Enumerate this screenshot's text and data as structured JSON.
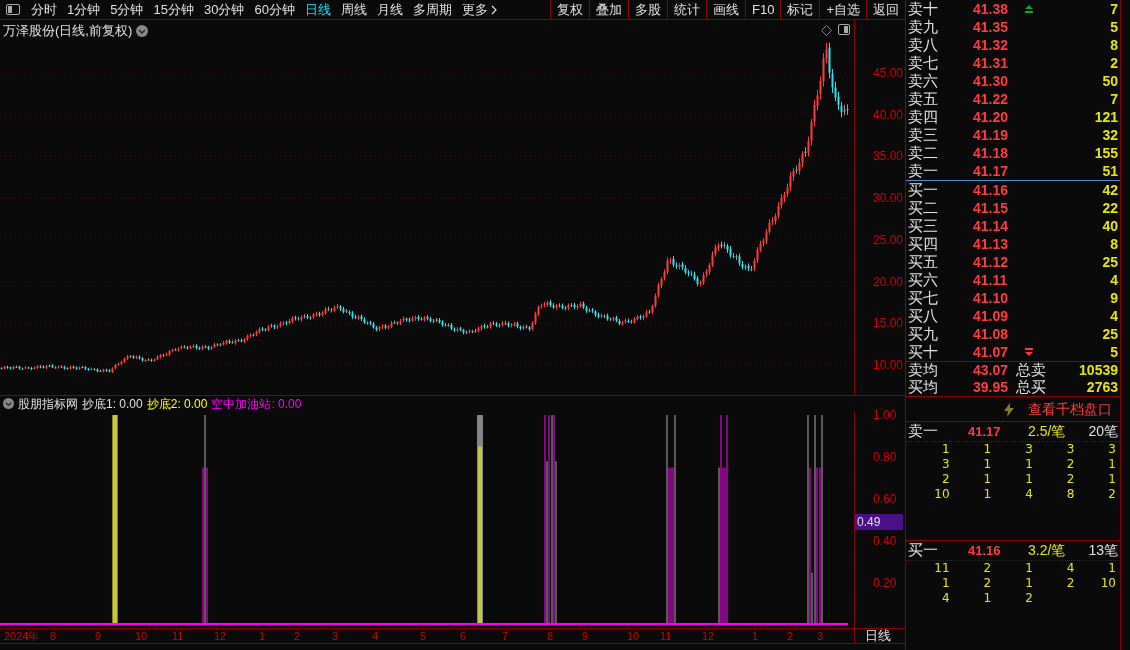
{
  "toolbar": {
    "periods": [
      {
        "label": "分时",
        "selected": false
      },
      {
        "label": "1分钟",
        "selected": false
      },
      {
        "label": "5分钟",
        "selected": false
      },
      {
        "label": "15分钟",
        "selected": false
      },
      {
        "label": "30分钟",
        "selected": false
      },
      {
        "label": "60分钟",
        "selected": false
      },
      {
        "label": "日线",
        "selected": true
      },
      {
        "label": "周线",
        "selected": false
      },
      {
        "label": "月线",
        "selected": false
      },
      {
        "label": "多周期",
        "selected": false
      },
      {
        "label": "更多",
        "selected": false
      }
    ],
    "buttons": [
      "复权",
      "叠加",
      "多股",
      "统计",
      "画线",
      "F10",
      "标记",
      "+自选",
      "返回"
    ]
  },
  "chart": {
    "title": "万泽股份(日线,前复权)",
    "yticks": [
      "45.00",
      "40.00",
      "35.00",
      "30.00",
      "25.00",
      "20.00",
      "15.00",
      "10.00"
    ]
  },
  "indicator": {
    "name": "股朋指标网",
    "values": [
      {
        "text": "抄底1: 0.00",
        "color": "#e0e0e0"
      },
      {
        "text": "抄底2: 0.00",
        "color": "#ffff00"
      },
      {
        "text": "空中加油站: 0.00",
        "color": "#ff00ff"
      }
    ],
    "yticks": [
      "1.00",
      "0.80",
      "0.60",
      "0.40",
      "0.20"
    ],
    "cursor_value": "0.49"
  },
  "xaxis": {
    "labels": [
      "2024年",
      "8",
      "9",
      "10",
      "11",
      "12",
      "1",
      "2",
      "3",
      "4",
      "5",
      "6",
      "7",
      "8",
      "9",
      "10",
      "11",
      "12",
      "1",
      "2",
      "3"
    ],
    "period": "日线"
  },
  "order_book": {
    "asks": [
      {
        "label": "卖十",
        "price": "41.38",
        "volume": "7",
        "flag": true
      },
      {
        "label": "卖九",
        "price": "41.35",
        "volume": "5",
        "flag": false
      },
      {
        "label": "卖八",
        "price": "41.32",
        "volume": "8",
        "flag": false
      },
      {
        "label": "卖七",
        "price": "41.31",
        "volume": "2",
        "flag": false
      },
      {
        "label": "卖六",
        "price": "41.30",
        "volume": "50",
        "flag": false
      },
      {
        "label": "卖五",
        "price": "41.22",
        "volume": "7",
        "flag": false
      },
      {
        "label": "卖四",
        "price": "41.20",
        "volume": "121",
        "flag": false
      },
      {
        "label": "卖三",
        "price": "41.19",
        "volume": "32",
        "flag": false
      },
      {
        "label": "卖二",
        "price": "41.18",
        "volume": "155",
        "flag": false
      },
      {
        "label": "卖一",
        "price": "41.17",
        "volume": "51",
        "flag": false
      }
    ],
    "bids": [
      {
        "label": "买一",
        "price": "41.16",
        "volume": "42",
        "flag": false
      },
      {
        "label": "买二",
        "price": "41.15",
        "volume": "22",
        "flag": false
      },
      {
        "label": "买三",
        "price": "41.14",
        "volume": "40",
        "flag": false
      },
      {
        "label": "买四",
        "price": "41.13",
        "volume": "8",
        "flag": false
      },
      {
        "label": "买五",
        "price": "41.12",
        "volume": "25",
        "flag": false
      },
      {
        "label": "买六",
        "price": "41.11",
        "volume": "4",
        "flag": false
      },
      {
        "label": "买七",
        "price": "41.10",
        "volume": "9",
        "flag": false
      },
      {
        "label": "买八",
        "price": "41.09",
        "volume": "4",
        "flag": false
      },
      {
        "label": "买九",
        "price": "41.08",
        "volume": "25",
        "flag": false
      },
      {
        "label": "买十",
        "price": "41.07",
        "volume": "5",
        "flag": true
      }
    ],
    "summary": [
      {
        "label": "卖均",
        "price": "43.07",
        "total_label": "总卖",
        "total": "10539"
      },
      {
        "label": "买均",
        "price": "39.95",
        "total_label": "总买",
        "total": "2763"
      }
    ]
  },
  "queue": {
    "link": "查看千档盘口",
    "sides": [
      {
        "label": "卖一",
        "price": "41.17",
        "average": "2.5/笔",
        "count": "20笔",
        "rows": [
          [
            "1",
            "1",
            "3",
            "3",
            "3"
          ],
          [
            "3",
            "1",
            "1",
            "2",
            "1"
          ],
          [
            "2",
            "1",
            "1",
            "2",
            "1"
          ],
          [
            "10",
            "1",
            "4",
            "8",
            "2"
          ]
        ]
      },
      {
        "label": "买一",
        "price": "41.16",
        "average": "3.2/笔",
        "count": "13笔",
        "rows": [
          [
            "11",
            "2",
            "1",
            "4",
            "1"
          ],
          [
            "1",
            "2",
            "1",
            "2",
            "10"
          ],
          [
            "4",
            "1",
            "2"
          ]
        ]
      }
    ]
  }
}
